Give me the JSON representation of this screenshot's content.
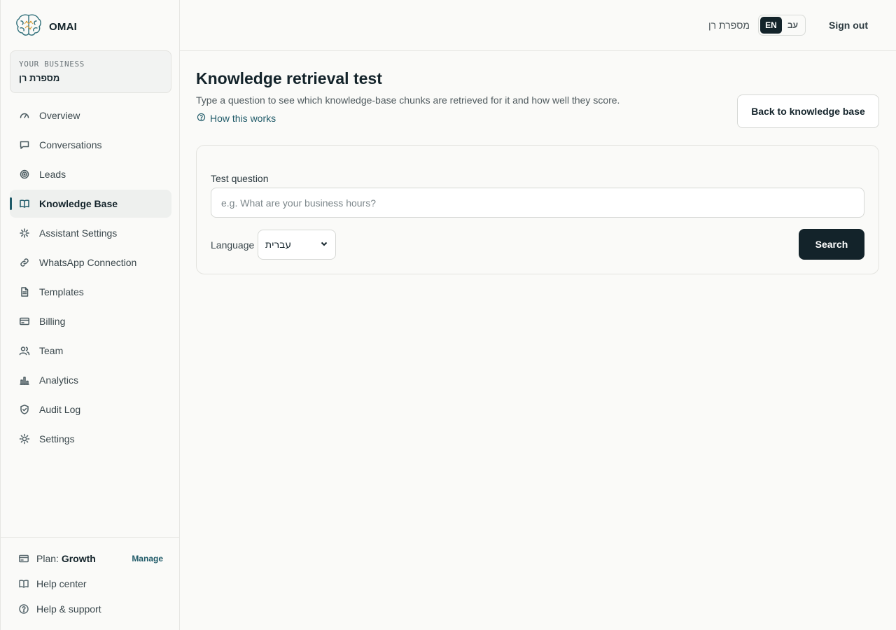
{
  "brand": {
    "name": "OMAI",
    "logo_icon": "brain-icon"
  },
  "business": {
    "label": "YOUR BUSINESS",
    "name": "מספרת רן"
  },
  "nav": {
    "items": [
      {
        "label": "Overview",
        "icon": "gauge-icon"
      },
      {
        "label": "Conversations",
        "icon": "chat-icon"
      },
      {
        "label": "Leads",
        "icon": "target-icon"
      },
      {
        "label": "Knowledge Base",
        "icon": "book-icon",
        "active": true
      },
      {
        "label": "Assistant Settings",
        "icon": "sparkle-icon"
      },
      {
        "label": "WhatsApp Connection",
        "icon": "link-icon"
      },
      {
        "label": "Templates",
        "icon": "file-icon"
      },
      {
        "label": "Billing",
        "icon": "card-icon"
      },
      {
        "label": "Team",
        "icon": "users-icon"
      },
      {
        "label": "Analytics",
        "icon": "bar-chart-icon"
      },
      {
        "label": "Audit Log",
        "icon": "shield-icon"
      },
      {
        "label": "Settings",
        "icon": "sun-gear-icon"
      }
    ]
  },
  "footer": {
    "plan_label": "Plan:",
    "plan_value": "Growth",
    "manage_label": "Manage",
    "help_center": "Help center",
    "help_support": "Help & support"
  },
  "header": {
    "business_name": "מספרת רן",
    "lang_en": "EN",
    "lang_he": "עב",
    "active_lang": "EN",
    "sign_out": "Sign out"
  },
  "main": {
    "title": "Knowledge retrieval test",
    "subtitle": "Type a question to see which knowledge-base chunks are retrieved for it and how well they score.",
    "how_link": "How this works",
    "back_button": "Back to knowledge base",
    "question_label": "Test question",
    "question_placeholder": "e.g. What are your business hours?",
    "question_value": "",
    "language_label": "Language",
    "language_selected": "עברית",
    "search_button": "Search"
  },
  "colors": {
    "accent": "#1f5a68",
    "primary_dark": "#13232a",
    "background": "#fafaf8"
  }
}
